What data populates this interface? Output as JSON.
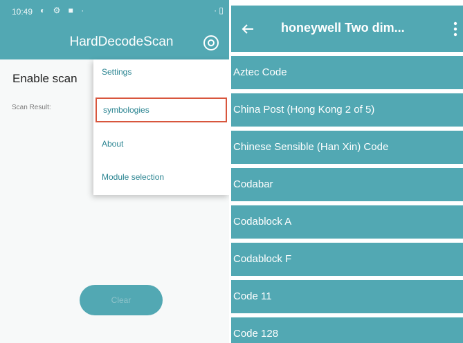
{
  "left_phone": {
    "status_bar": {
      "time": "10:49",
      "icons": "◐ ⚙ ■ ·",
      "right": "· ▯"
    },
    "app_title": "HardDecodeScan",
    "enable_scan_text": "Enable scan",
    "scan_result_label": "Scan Result:",
    "clear_button": "Clear",
    "menu": {
      "items": [
        {
          "label": "Settings"
        },
        {
          "label": "symbologies"
        },
        {
          "label": "About"
        },
        {
          "label": "Module selection"
        }
      ],
      "highlight_color": "#d8563d"
    }
  },
  "right_phone": {
    "title": "honeywell Two dim...",
    "symbologies": [
      {
        "label": "Aztec Code"
      },
      {
        "label": "China Post (Hong Kong 2 of 5)"
      },
      {
        "label": "Chinese Sensible (Han Xin) Code"
      },
      {
        "label": "Codabar"
      },
      {
        "label": "Codablock A"
      },
      {
        "label": "Codablock F"
      },
      {
        "label": "Code 11"
      },
      {
        "label": "Code 128"
      }
    ]
  },
  "colors": {
    "accent": "#52a8b3",
    "menu_text": "#2a8491"
  },
  "icons": {
    "settings": "gear-icon",
    "back": "arrow-left-icon",
    "overflow": "more-vertical-icon"
  }
}
